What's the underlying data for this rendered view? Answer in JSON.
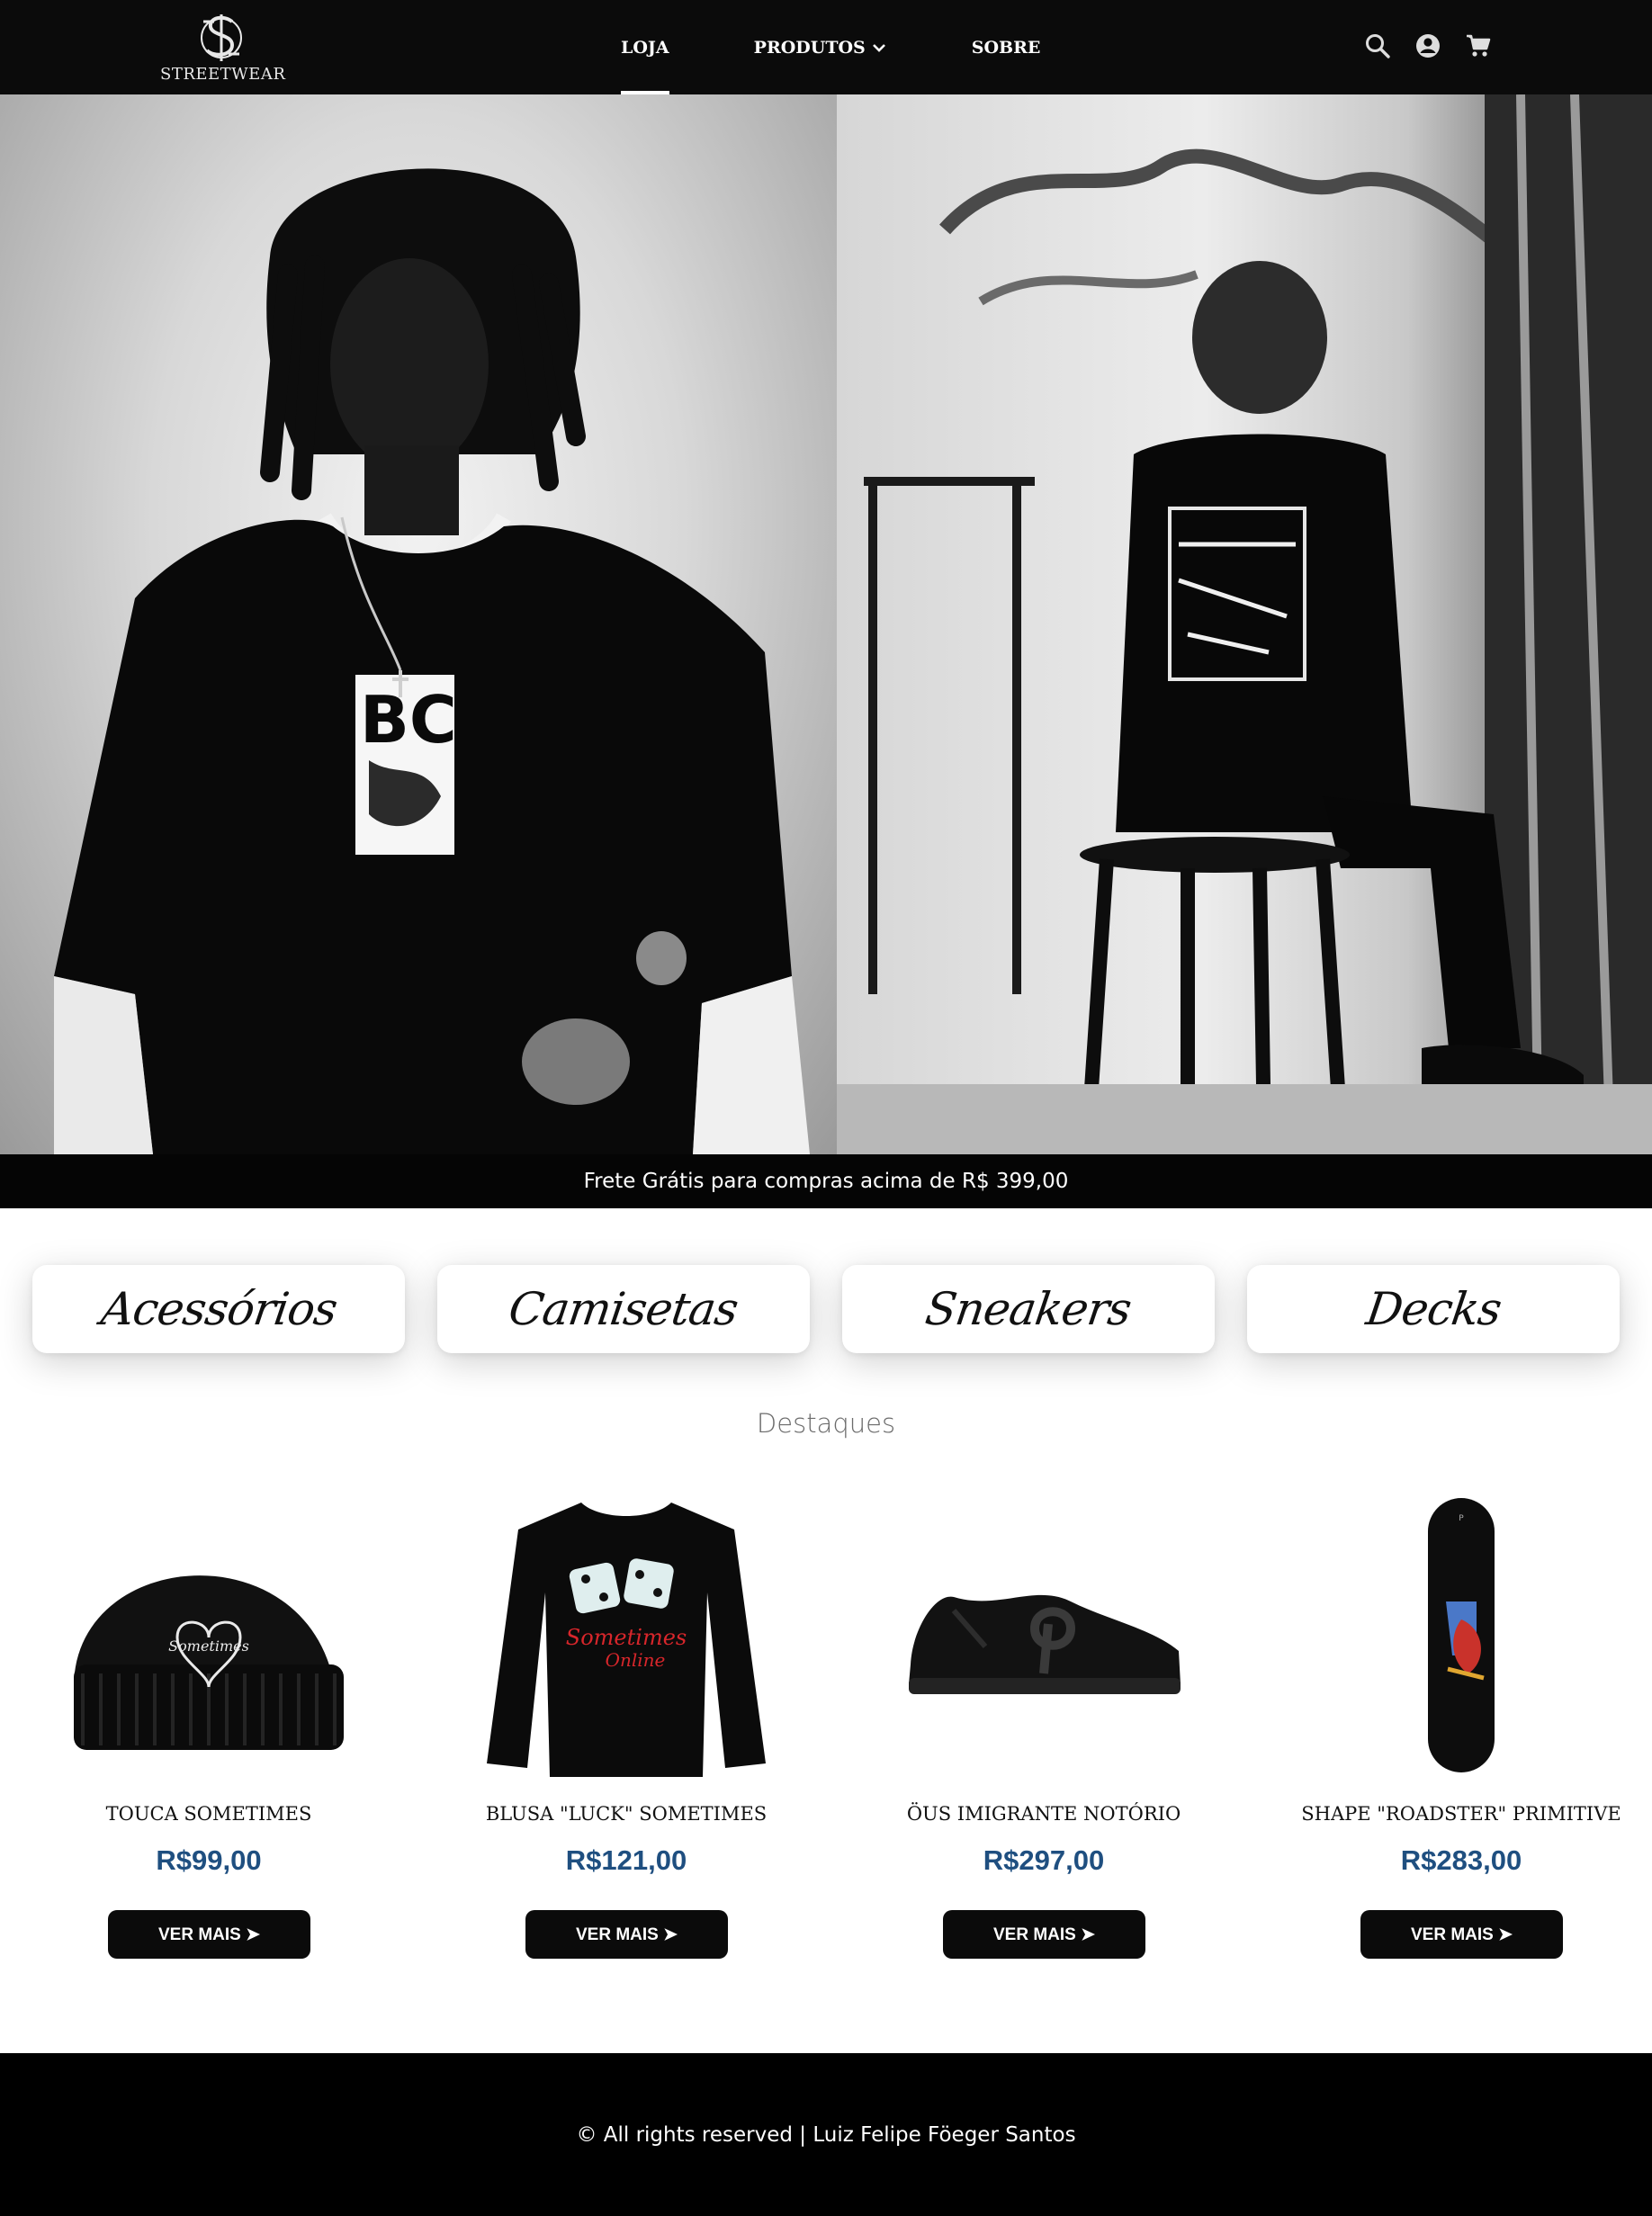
{
  "brand": {
    "logo_text": "STREETWEAR"
  },
  "nav": {
    "links": [
      {
        "label": "LOJA",
        "active": true
      },
      {
        "label": "PRODUTOS",
        "has_dropdown": true
      },
      {
        "label": "SOBRE"
      }
    ],
    "icons": [
      "search-icon",
      "account-icon",
      "cart-icon"
    ]
  },
  "hero": {
    "images": [
      {
        "subject": "person-black-tee-dreadlocks"
      },
      {
        "subject": "person-seated-on-stool-graphic-tee"
      }
    ]
  },
  "promo": {
    "text": "Frete Grátis para compras acima de R$ 399,00"
  },
  "categories": [
    {
      "label": "Acessórios"
    },
    {
      "label": "Camisetas"
    },
    {
      "label": "Sneakers"
    },
    {
      "label": "Decks"
    }
  ],
  "featured": {
    "title": "Destaques",
    "products": [
      {
        "name": "TOUCA SOMETIMES",
        "price": "R$99,00",
        "button": "VER MAIS ➤",
        "image": "beanie"
      },
      {
        "name": "BLUSA \"LUCK\" SOMETIMES",
        "price": "R$121,00",
        "button": "VER MAIS ➤",
        "image": "longsleeve"
      },
      {
        "name": "ÖUS IMIGRANTE NOTÓRIO",
        "price": "R$297,00",
        "button": "VER MAIS ➤",
        "image": "sneaker"
      },
      {
        "name": "SHAPE \"ROADSTER\" PRIMITIVE",
        "price": "R$283,00",
        "button": "VER MAIS ➤",
        "image": "skateboard-deck"
      }
    ]
  },
  "footer": {
    "text": "© All rights reserved | Luiz Felipe Föeger Santos"
  },
  "colors": {
    "nav_bg": "#0b0b0b",
    "price": "#1f4f80",
    "button_bg": "#0b0b0b",
    "footer_bg": "#000000"
  }
}
